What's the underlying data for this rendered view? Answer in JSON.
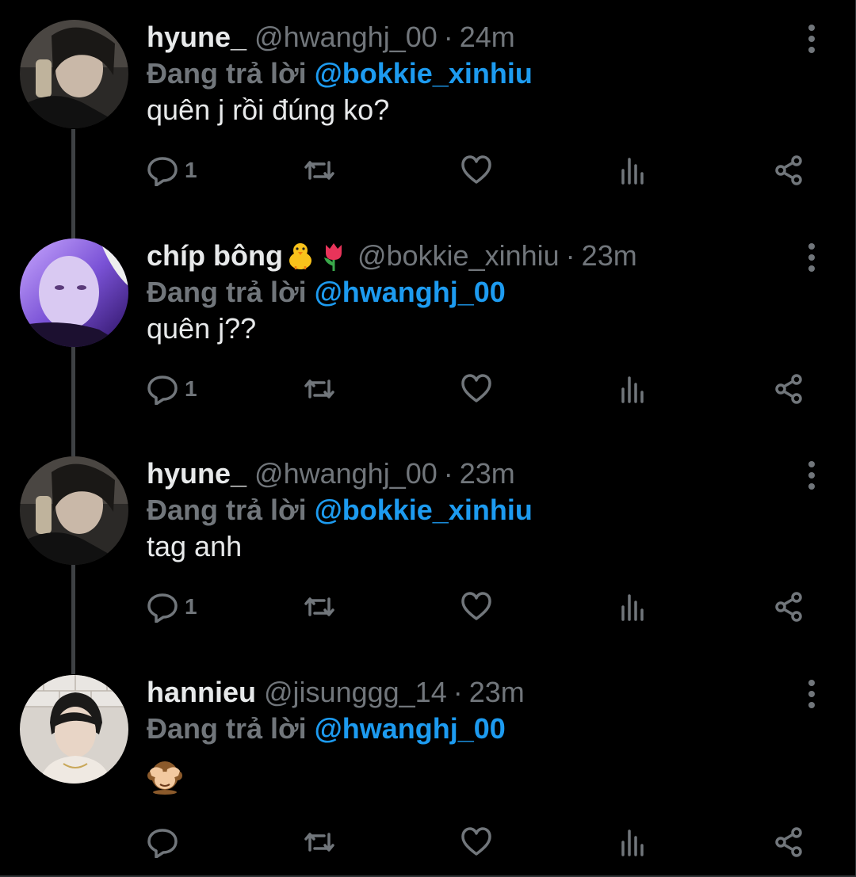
{
  "tweets": [
    {
      "name": "hyune_",
      "handle": "@hwanghj_00",
      "time": "24m",
      "replying_prefix": "Đang trả lời",
      "replying_to": "@bokkie_xinhiu",
      "text": "quên j rồi đúng ko?",
      "reply_count": "1",
      "name_emojis": []
    },
    {
      "name": "chíp bông",
      "handle": "@bokkie_xinhiu",
      "time": "23m",
      "replying_prefix": "Đang trả lời",
      "replying_to": "@hwanghj_00",
      "text": "quên j??",
      "reply_count": "1",
      "name_emojis": [
        "baby-chick-emoji",
        "tulip-emoji"
      ]
    },
    {
      "name": "hyune_",
      "handle": "@hwanghj_00",
      "time": "23m",
      "replying_prefix": "Đang trả lời",
      "replying_to": "@bokkie_xinhiu",
      "text": "tag anh",
      "reply_count": "1",
      "name_emojis": []
    },
    {
      "name": "hannieu",
      "handle": "@jisunggg_14",
      "time": "23m",
      "replying_prefix": "Đang trả lời",
      "replying_to": "@hwanghj_00",
      "text": "",
      "body_emoji": "see-no-evil-monkey-emoji",
      "reply_count": "",
      "name_emojis": []
    }
  ],
  "separator": "·",
  "icons": [
    "reply-icon",
    "retweet-icon",
    "like-icon",
    "views-icon",
    "share-icon",
    "more-icon"
  ],
  "colors": {
    "background": "#000000",
    "text": "#e7e9ea",
    "secondary": "#71767b",
    "mention": "#1d9bf0",
    "thread_line": "#3e4144"
  }
}
